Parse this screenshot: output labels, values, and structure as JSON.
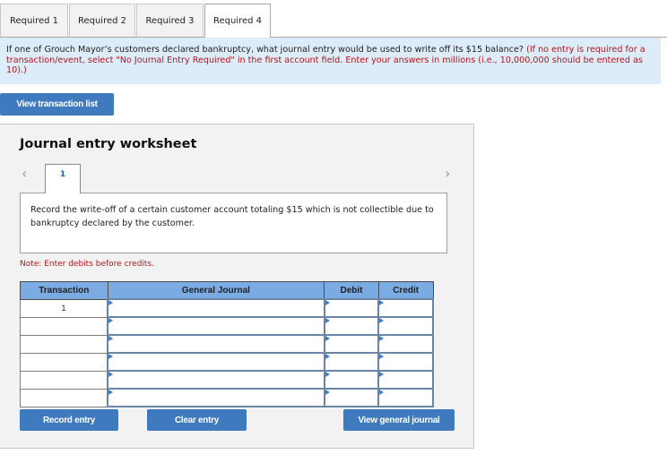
{
  "tabs": [
    {
      "label": "Required 1",
      "active": false
    },
    {
      "label": "Required 2",
      "active": false
    },
    {
      "label": "Required 3",
      "active": false
    },
    {
      "label": "Required 4",
      "active": true
    }
  ],
  "question": {
    "text": "If one of Grouch Mayor’s customers declared bankruptcy, what journal entry would be used to write off its $15 balance?",
    "hint": "(If no entry is required for a transaction/event, select \"No Journal Entry Required\" in the first account field. Enter your answers in millions (i.e., 10,000,000 should be entered as 10).)"
  },
  "buttons": {
    "view_transaction_list": "View transaction list",
    "record_entry": "Record entry",
    "clear_entry": "Clear entry",
    "view_general_journal": "View general journal"
  },
  "worksheet": {
    "title": "Journal entry worksheet",
    "prev_icon": "‹",
    "next_icon": "›",
    "current_entry": "1",
    "description": "Record the write-off of a certain customer account totaling $15 which is not collectible due to bankruptcy declared by the customer.",
    "note": "Note: Enter debits before credits."
  },
  "table": {
    "headers": {
      "transaction": "Transaction",
      "general_journal": "General Journal",
      "debit": "Debit",
      "credit": "Credit"
    },
    "rows": [
      {
        "transaction": "1",
        "account": "",
        "debit": "",
        "credit": ""
      },
      {
        "transaction": "",
        "account": "",
        "debit": "",
        "credit": ""
      },
      {
        "transaction": "",
        "account": "",
        "debit": "",
        "credit": ""
      },
      {
        "transaction": "",
        "account": "",
        "debit": "",
        "credit": ""
      },
      {
        "transaction": "",
        "account": "",
        "debit": "",
        "credit": ""
      },
      {
        "transaction": "",
        "account": "",
        "debit": "",
        "credit": ""
      }
    ]
  },
  "colors": {
    "accent_button": "#3f7abf",
    "table_header": "#7aabe2",
    "question_bg": "#dcecf9",
    "hint_red": "#b5161b"
  }
}
